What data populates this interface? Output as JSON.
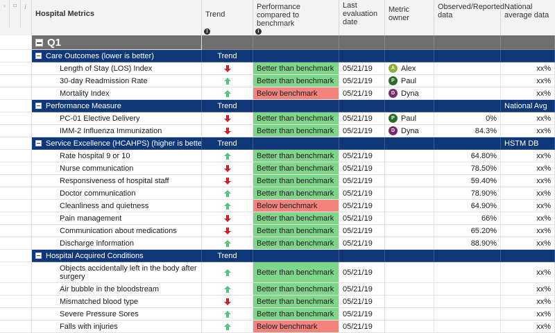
{
  "header": {
    "title": "Hospital Metrics",
    "trend": "Trend",
    "performance": "Performance compared to benchmark",
    "last_eval": "Last evaluation date",
    "owner": "Metric owner",
    "observed": "Observed/Reported data",
    "national": "National average data"
  },
  "quarter": "Q1",
  "colors": {
    "section_blue": "#0e3878",
    "better": "#7fd58a",
    "below": "#f4837e",
    "up_arrow": "#5cc17a",
    "down_arrow": "#d0202a"
  },
  "sections": [
    {
      "title": "Care Outcomes (lower is better)",
      "trend_label": "Trend",
      "national_label": "",
      "rows": [
        {
          "name": "Length of Stay (LOS) Index",
          "trend": "down",
          "performance": "Better than benchmark",
          "status": "better",
          "date": "05/21/19",
          "owner": "Alex",
          "owner_initial": "A",
          "owner_color": "#8db03c",
          "observed": "",
          "national": "xx%"
        },
        {
          "name": "30-day Readmission Rate",
          "trend": "up",
          "performance": "Better than benchmark",
          "status": "better",
          "date": "05/21/19",
          "owner": "Paul",
          "owner_initial": "P",
          "owner_color": "#2e6b2a",
          "observed": "",
          "national": "xx%"
        },
        {
          "name": "Mortality Index",
          "trend": "up",
          "performance": "Below benchmark",
          "status": "below",
          "date": "05/21/19",
          "owner": "Dyna",
          "owner_initial": "D",
          "owner_color": "#7a2a6b",
          "observed": "",
          "national": "xx%"
        }
      ]
    },
    {
      "title": "Performance Measure",
      "trend_label": "Trend",
      "national_label": "National Avg",
      "rows": [
        {
          "name": "PC-01 Elective Delivery",
          "trend": "down",
          "performance": "Better than benchmark",
          "status": "better",
          "date": "05/21/19",
          "owner": "Paul",
          "owner_initial": "P",
          "owner_color": "#2e6b2a",
          "observed": "0%",
          "national": "xx%"
        },
        {
          "name": "IMM-2 Influenza Immunization",
          "trend": "down",
          "performance": "Better than benchmark",
          "status": "better",
          "date": "05/21/19",
          "owner": "Dyna",
          "owner_initial": "D",
          "owner_color": "#7a2a6b",
          "observed": "84.3%",
          "national": "xx%"
        }
      ]
    },
    {
      "title": "Service Excellence (HCAHPS) (higher is better)",
      "trend_label": "Trend",
      "national_label": "HSTM DB",
      "rows": [
        {
          "name": "Rate hospital 9 or 10",
          "trend": "up",
          "performance": "Better than benchmark",
          "status": "better",
          "date": "05/21/19",
          "owner": "",
          "observed": "64.80%",
          "national": "xx%"
        },
        {
          "name": "Nurse communication",
          "trend": "down",
          "performance": "Better than benchmark",
          "status": "better",
          "date": "05/21/19",
          "owner": "",
          "observed": "78.50%",
          "national": "xx%"
        },
        {
          "name": "Responsiveness of hospital staff",
          "trend": "down",
          "performance": "Better than benchmark",
          "status": "better",
          "date": "05/21/19",
          "owner": "",
          "observed": "59.40%",
          "national": "xx%"
        },
        {
          "name": "Doctor communication",
          "trend": "up",
          "performance": "Better than benchmark",
          "status": "better",
          "date": "05/21/19",
          "owner": "",
          "observed": "78.90%",
          "national": "xx%"
        },
        {
          "name": "Cleanliness and quietness",
          "trend": "up",
          "performance": "Below benchmark",
          "status": "below",
          "date": "05/21/19",
          "owner": "",
          "observed": "64.90%",
          "national": "xx%"
        },
        {
          "name": "Pain management",
          "trend": "down",
          "performance": "Better than benchmark",
          "status": "better",
          "date": "05/21/19",
          "owner": "",
          "observed": "66%",
          "national": "xx%"
        },
        {
          "name": "Communication about medications",
          "trend": "down",
          "performance": "Better than benchmark",
          "status": "better",
          "date": "05/21/19",
          "owner": "",
          "observed": "65.20%",
          "national": "xx%"
        },
        {
          "name": "Discharge information",
          "trend": "up",
          "performance": "Better than benchmark",
          "status": "better",
          "date": "05/21/19",
          "owner": "",
          "observed": "88.90%",
          "national": "xx%"
        }
      ]
    },
    {
      "title": "Hospital Acquired Conditions",
      "trend_label": "Trend",
      "national_label": "",
      "rows": [
        {
          "name": "Objects accidentally left in the body after surgery",
          "trend": "up",
          "performance": "Better than benchmark",
          "status": "better",
          "date": "05/21/19",
          "owner": "",
          "observed": "",
          "national": "xx%",
          "tall": true
        },
        {
          "name": "Air bubble in the bloodstream",
          "trend": "up",
          "performance": "Better than benchmark",
          "status": "better",
          "date": "05/21/19",
          "owner": "",
          "observed": "",
          "national": "xx%"
        },
        {
          "name": "Mismatched blood type",
          "trend": "down",
          "performance": "Better than benchmark",
          "status": "better",
          "date": "05/21/19",
          "owner": "",
          "observed": "",
          "national": "xx%"
        },
        {
          "name": "Severe Pressure Sores",
          "trend": "up",
          "performance": "Better than benchmark",
          "status": "better",
          "date": "05/21/19",
          "owner": "",
          "observed": "",
          "national": "xx%"
        },
        {
          "name": "Falls with injuries",
          "trend": "up",
          "performance": "Below benchmark",
          "status": "below",
          "date": "05/21/19",
          "owner": "",
          "observed": "",
          "national": "xx%"
        }
      ]
    }
  ]
}
